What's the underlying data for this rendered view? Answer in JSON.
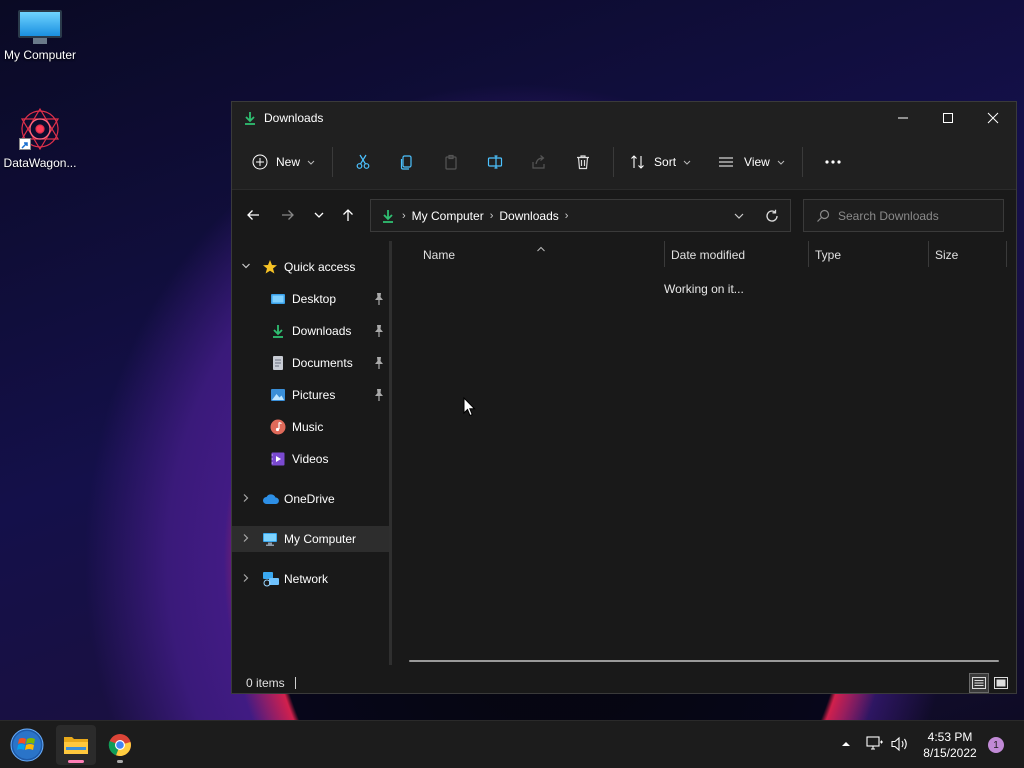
{
  "desktop": {
    "icons": [
      {
        "label": "My Computer"
      },
      {
        "label": "DataWagon..."
      }
    ]
  },
  "window": {
    "title": "Downloads",
    "toolbar": {
      "new_label": "New",
      "sort_label": "Sort",
      "view_label": "View"
    },
    "address": {
      "crumbs": [
        "My Computer",
        "Downloads"
      ]
    },
    "search": {
      "placeholder": "Search Downloads"
    },
    "sidebar": {
      "items": [
        {
          "label": "Quick access"
        },
        {
          "label": "Desktop"
        },
        {
          "label": "Downloads"
        },
        {
          "label": "Documents"
        },
        {
          "label": "Pictures"
        },
        {
          "label": "Music"
        },
        {
          "label": "Videos"
        },
        {
          "label": "OneDrive"
        },
        {
          "label": "My Computer"
        },
        {
          "label": "Network"
        }
      ]
    },
    "columns": [
      "Name",
      "Date modified",
      "Type",
      "Size"
    ],
    "status_message": "Working on it...",
    "statusbar": {
      "count": "0 items"
    }
  },
  "taskbar": {
    "time": "4:53 PM",
    "date": "8/15/2022",
    "notification_count": "1"
  },
  "colors": {
    "accent": "#4cc2ff",
    "download_green": "#2fbf71",
    "window_bg": "#191919",
    "taskbar_bg": "#1c1c1c"
  }
}
